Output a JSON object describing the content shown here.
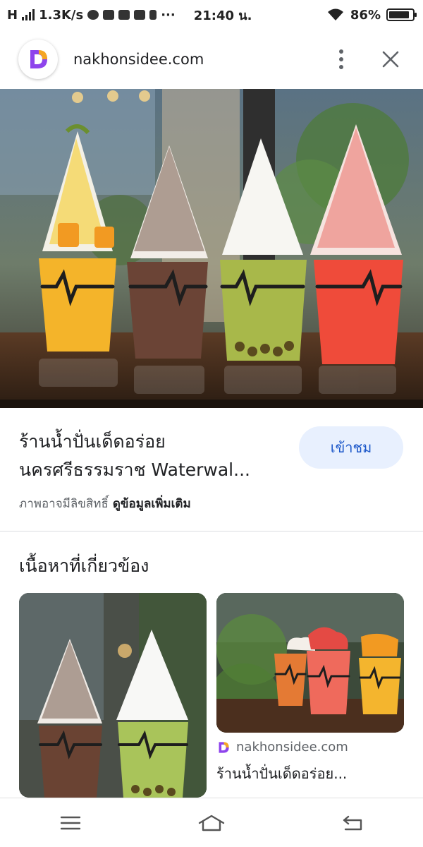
{
  "status_bar": {
    "network": "H",
    "speed": "1.3K/s",
    "time": "21:40 น.",
    "battery": "86%",
    "battery_level": 0.86,
    "more": "···"
  },
  "browser": {
    "url": "nakhonsidee.com",
    "logo_icon": "nakhonsidee-logo",
    "menu_icon": "more-vert-icon",
    "close_icon": "close-icon"
  },
  "result": {
    "title_line1": "ร้านน้ำปั่นเด็ดอร่อย",
    "title_line2": "นครศรีธรรมราช Waterwal...",
    "view_button": "เข้าชม",
    "copyright": "ภาพอาจมีลิขสิทธิ์",
    "more_info": "ดูข้อมูลเพิ่มเติม"
  },
  "related": {
    "heading": "เนื้อหาที่เกี่ยวข้อง",
    "item2_source": "nakhonsidee.com",
    "item2_title": "ร้านน้ำปั่นเด็ดอร่อย..."
  },
  "nav": {
    "menu_icon": "recents-icon",
    "home_icon": "home-icon",
    "back_icon": "back-icon"
  },
  "colors": {
    "accent": "#1a56c9",
    "button_bg": "#e8f0fe",
    "logo_purple": "#8e44ec",
    "logo_orange": "#f5a623"
  }
}
